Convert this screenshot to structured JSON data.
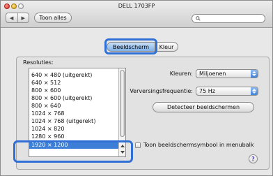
{
  "window": {
    "title": "DELL 1703FP"
  },
  "toolbar": {
    "back_icon": "back-arrow",
    "forward_icon": "forward-arrow",
    "show_all_label": "Toon alles",
    "search_placeholder": ""
  },
  "tabs": [
    {
      "label": "Beeldscherm",
      "selected": true
    },
    {
      "label": "Kleur",
      "selected": false
    }
  ],
  "resolutions": {
    "label": "Resoluties:",
    "items": [
      "640 × 480 (uitgerekt)",
      "640 × 512",
      "800 × 600",
      "800 × 600 (uitgerekt)",
      "800 × 640",
      "1024 × 768",
      "1024 × 768 (uitgerekt)",
      "1024 × 820",
      "1280 × 960",
      "1920 × 1200"
    ],
    "selected": "1920 × 1200"
  },
  "settings": {
    "colors_label": "Kleuren:",
    "colors_value": "Miljoenen",
    "refresh_label": "Verversingsfrequentie:",
    "refresh_value": "75 Hz",
    "detect_label": "Detecteer beeldschermen",
    "menubar_label": "Toon beeldschermsymbool in menubalk",
    "menubar_checked": false
  },
  "help": {
    "label": "?"
  },
  "colors": {
    "highlight": "#2f6fd6",
    "selection": "#3d7fd6"
  }
}
